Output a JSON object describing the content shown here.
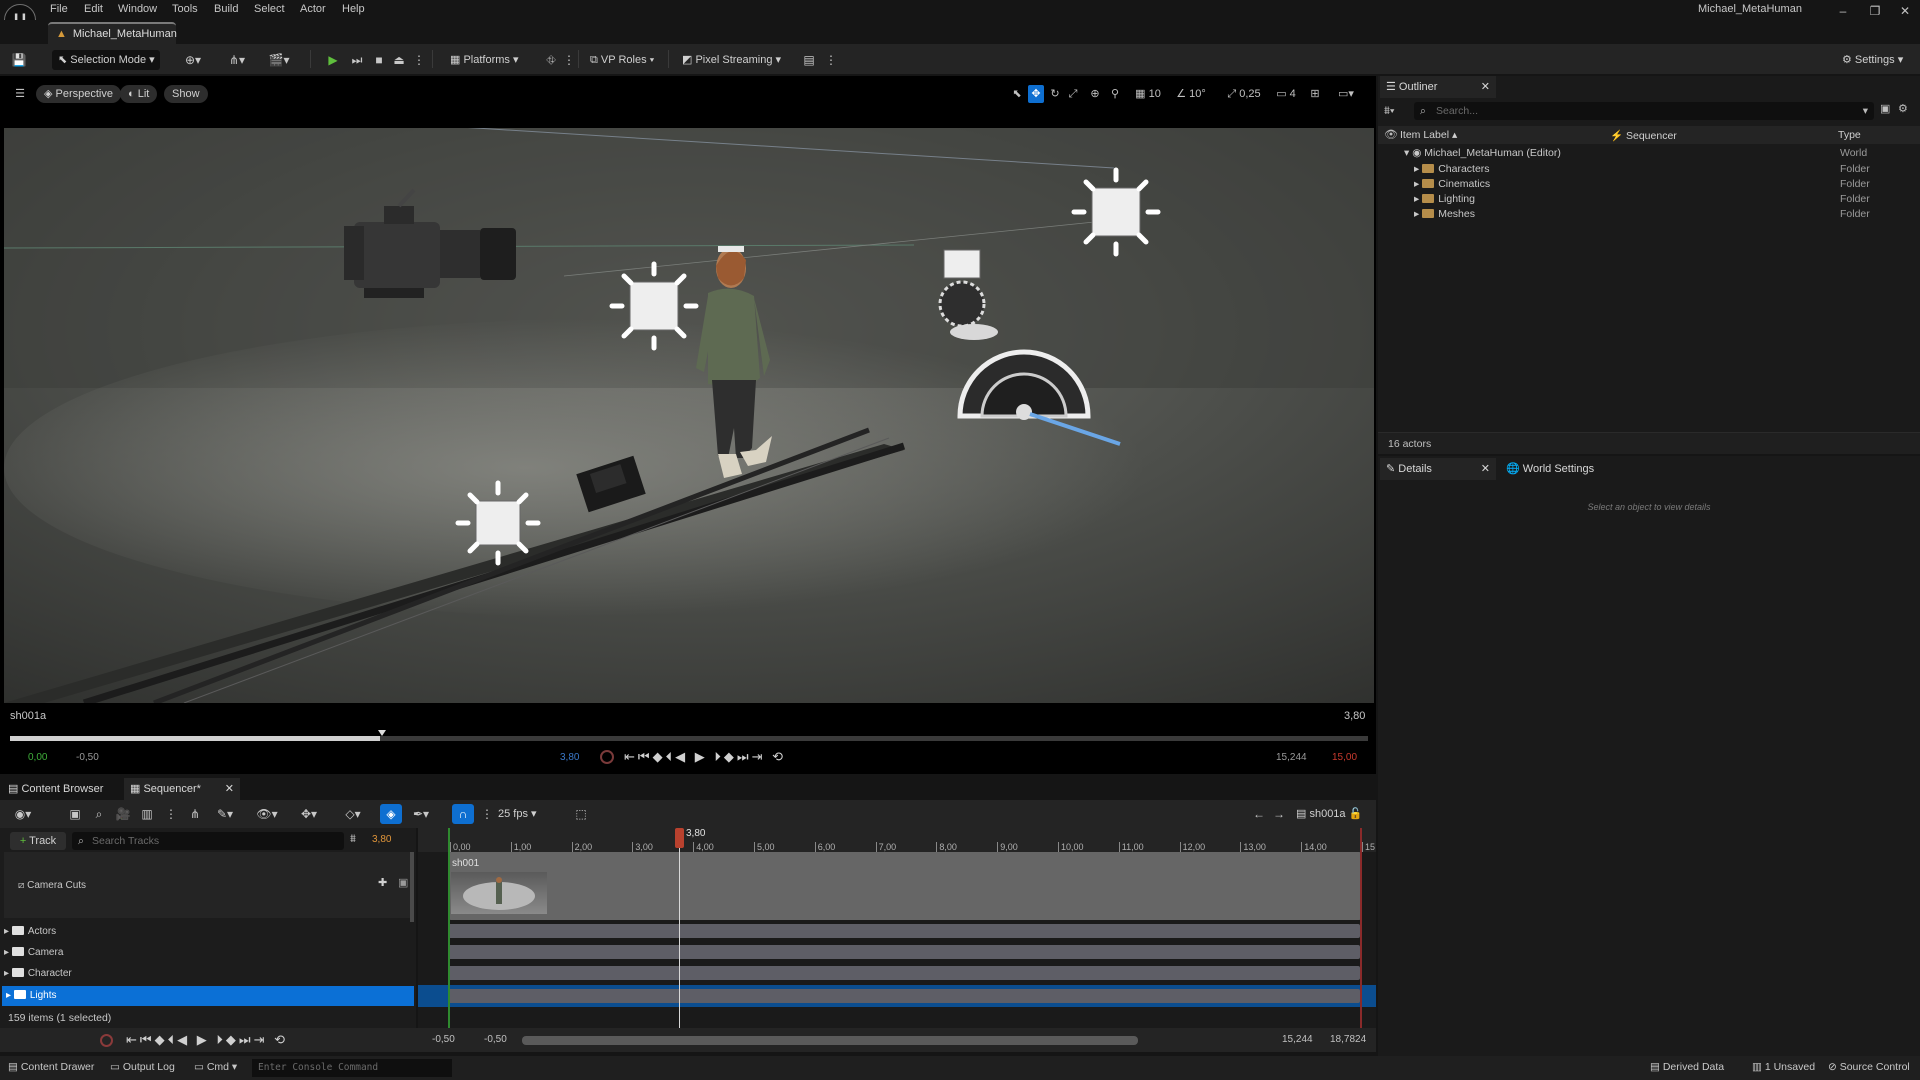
{
  "menubar": {
    "logo": "U",
    "items": [
      "File",
      "Edit",
      "Window",
      "Tools",
      "Build",
      "Select",
      "Actor",
      "Help"
    ],
    "window_title": "Michael_MetaHuman"
  },
  "tab": {
    "label": "Michael_MetaHuman"
  },
  "toolbar": {
    "selection_mode": "Selection Mode",
    "platforms": "Platforms",
    "vp_roles": "VP Roles",
    "pixel_streaming": "Pixel Streaming",
    "settings": "Settings"
  },
  "viewport": {
    "perspective": "Perspective",
    "lit": "Lit",
    "show": "Show",
    "grid_snap": "10",
    "rot_snap": "10°",
    "scale_snap": "0,25",
    "cam_speed": "4",
    "shot_name": "sh001a",
    "shot_time": "3,80",
    "time_start": "0,00",
    "time_neg": "-0,50",
    "time_current": "3,80",
    "time_end_left": "15,244",
    "time_end_red": "15,00"
  },
  "outliner": {
    "title": "Outliner",
    "search_placeholder": "Search...",
    "col_label": "Item Label",
    "col_seq": "Sequencer",
    "col_type": "Type",
    "rows": [
      {
        "label": "Michael_MetaHuman (Editor)",
        "type": "World"
      },
      {
        "label": "Characters",
        "type": "Folder"
      },
      {
        "label": "Cinematics",
        "type": "Folder"
      },
      {
        "label": "Lighting",
        "type": "Folder"
      },
      {
        "label": "Meshes",
        "type": "Folder"
      }
    ],
    "count": "16 actors"
  },
  "details": {
    "tab1": "Details",
    "tab2": "World Settings",
    "empty": "Select an object to view details"
  },
  "bottom_tabs": {
    "content_browser": "Content Browser",
    "sequencer": "Sequencer*"
  },
  "sequencer": {
    "fps": "25 fps",
    "sequence_name": "sh001a",
    "add_track": "Track",
    "search_placeholder": "Search Tracks",
    "current_time": "3,80",
    "playhead_label": "3,80",
    "ruler": [
      "0,00",
      "1,00",
      "2,00",
      "3,00",
      "4,00",
      "5,00",
      "6,00",
      "7,00",
      "8,00",
      "9,00",
      "10,00",
      "11,00",
      "12,00",
      "13,00",
      "14,00",
      "15"
    ],
    "tracks": [
      {
        "label": "Camera Cuts"
      },
      {
        "label": "Actors"
      },
      {
        "label": "Camera"
      },
      {
        "label": "Character"
      },
      {
        "label": "Lights"
      }
    ],
    "shot_clip": "sh001",
    "items_count": "159 items (1 selected)",
    "range_start": "-0,50",
    "range_start2": "-0,50",
    "range_end": "15,244",
    "range_end2": "18,7824"
  },
  "statusbar": {
    "content_drawer": "Content Drawer",
    "output_log": "Output Log",
    "cmd": "Cmd",
    "console_placeholder": "Enter Console Command",
    "derived_data": "Derived Data",
    "unsaved": "1 Unsaved",
    "source_control": "Source Control"
  },
  "colors": {
    "accent": "#0e6fd1",
    "selected": "#0b70d6",
    "playhead": "#b8412e",
    "folder": "#b58d4a"
  }
}
